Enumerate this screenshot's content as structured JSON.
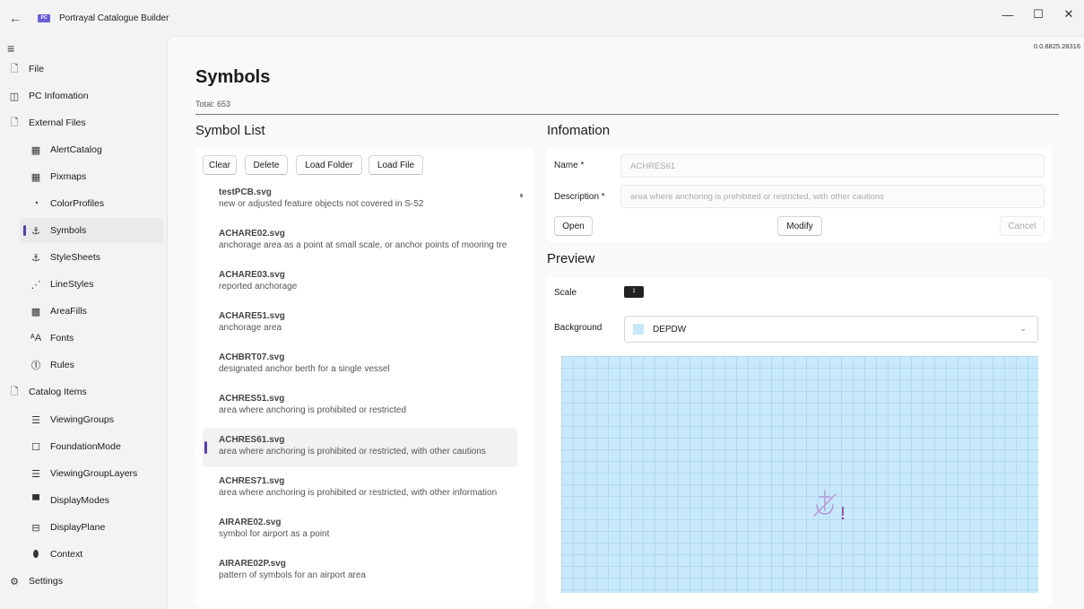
{
  "window": {
    "back_glyph": "←",
    "logo_text": "PC",
    "title": "Portrayal Catalogue Builder",
    "version": "0.0.8825.28316",
    "minimize_glyph": "—",
    "maximize_glyph": "☐",
    "close_glyph": "✕"
  },
  "sidebar": {
    "menu_glyph": "≡",
    "items": [
      {
        "label": "File",
        "icon": "document-icon",
        "glyph": "🗋"
      },
      {
        "label": "PC Infomation",
        "icon": "info-card-icon",
        "glyph": "◫"
      },
      {
        "label": "External Files",
        "icon": "folder-icon",
        "glyph": "🗋"
      },
      {
        "label": "AlertCatalog",
        "icon": "table-icon",
        "glyph": "▦"
      },
      {
        "label": "Pixmaps",
        "icon": "table-icon",
        "glyph": "▦"
      },
      {
        "label": "ColorProfiles",
        "icon": "palette-icon",
        "glyph": "◔"
      },
      {
        "label": "Symbols",
        "icon": "anchor-icon",
        "glyph": "⚓"
      },
      {
        "label": "StyleSheets",
        "icon": "anchor-icon",
        "glyph": "⚓"
      },
      {
        "label": "LineStyles",
        "icon": "line-icon",
        "glyph": "⋰"
      },
      {
        "label": "AreaFills",
        "icon": "pattern-icon",
        "glyph": "▩"
      },
      {
        "label": "Fonts",
        "icon": "font-icon",
        "glyph": "ᴬA"
      },
      {
        "label": "Rules",
        "icon": "rules-icon",
        "glyph": "⓵"
      },
      {
        "label": "Catalog Items",
        "icon": "folder-icon",
        "glyph": "🗋"
      },
      {
        "label": "ViewingGroups",
        "icon": "list-icon",
        "glyph": "☰"
      },
      {
        "label": "FoundationMode",
        "icon": "square-icon",
        "glyph": "☐"
      },
      {
        "label": "ViewingGroupLayers",
        "icon": "layers-icon",
        "glyph": "☰"
      },
      {
        "label": "DisplayModes",
        "icon": "monitor-icon",
        "glyph": "▀"
      },
      {
        "label": "DisplayPlane",
        "icon": "plane-icon",
        "glyph": "⊟"
      },
      {
        "label": "Context",
        "icon": "context-icon",
        "glyph": "⬮"
      },
      {
        "label": "Settings",
        "icon": "gear-icon",
        "glyph": "⚙"
      }
    ]
  },
  "page": {
    "title": "Symbols",
    "total": "Total: 653"
  },
  "symbol_list": {
    "heading": "Symbol List",
    "buttons": {
      "clear": "Clear",
      "delete": "Delete",
      "load_folder": "Load Folder",
      "load_file": "Load File"
    },
    "items": [
      {
        "name": "testPCB.svg",
        "desc": "new or adjusted feature objects not covered in S-52"
      },
      {
        "name": "ACHARE02.svg",
        "desc": "anchorage area as a point at small scale, or anchor points of mooring tre"
      },
      {
        "name": "ACHARE03.svg",
        "desc": "reported anchorage"
      },
      {
        "name": "ACHARE51.svg",
        "desc": "anchorage area"
      },
      {
        "name": "ACHBRT07.svg",
        "desc": "designated anchor berth for a single vessel"
      },
      {
        "name": "ACHRES51.svg",
        "desc": "area where anchoring is prohibited or restricted"
      },
      {
        "name": "ACHRES61.svg",
        "desc": "area where anchoring is prohibited or restricted, with other cautions"
      },
      {
        "name": "ACHRES71.svg",
        "desc": "area where anchoring is prohibited or restricted, with other information"
      },
      {
        "name": "AIRARE02.svg",
        "desc": "symbol for airport as a point"
      },
      {
        "name": "AIRARE02P.svg",
        "desc": "pattern of symbols for an airport area"
      }
    ]
  },
  "information": {
    "heading": "Infomation",
    "name_label": "Name *",
    "name_value": "ACHRES61",
    "description_label": "Description *",
    "description_value": "area where anchoring is prohibited or restricted, with other cautions",
    "open": "Open",
    "modify": "Modify",
    "cancel": "Cancel"
  },
  "preview": {
    "heading": "Preview",
    "scale_label": "Scale",
    "scale_value": "1",
    "background_label": "Background",
    "background_value": "DEPDW",
    "chevron_glyph": "⌄"
  },
  "colors": {
    "accent": "#5b3fa8",
    "canvas_bg": "#c8e8fb",
    "symbol_stroke": "#b598d8"
  }
}
